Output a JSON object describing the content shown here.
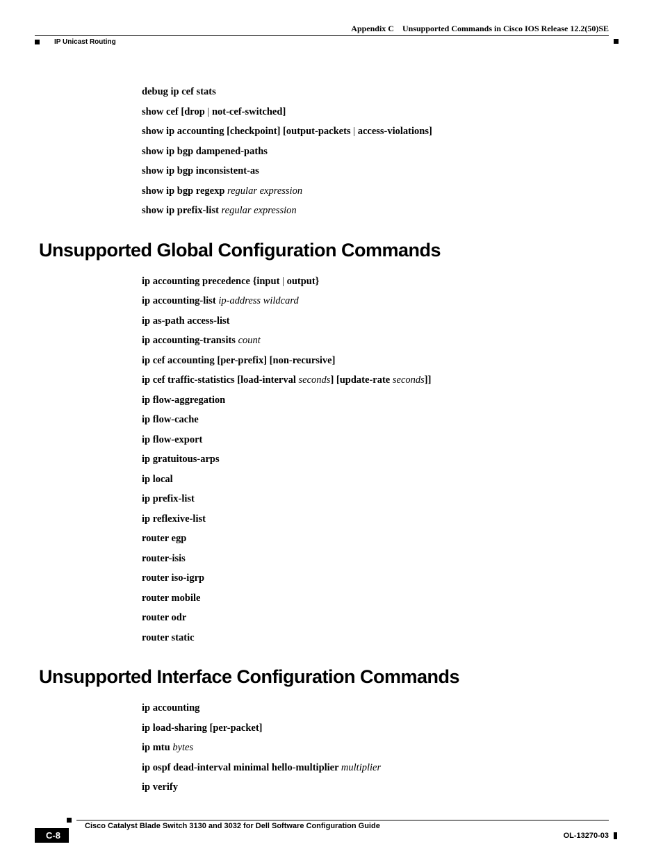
{
  "header": {
    "appendix_bold": "Appendix C",
    "appendix_text": "Unsupported Commands in Cisco IOS Release 12.2(50)SE",
    "section": "IP Unicast Routing"
  },
  "block1": [
    [
      {
        "t": "debug ip cef stats",
        "b": true
      }
    ],
    [
      {
        "t": "show cef ",
        "b": true
      },
      {
        "t": "[",
        "b": true
      },
      {
        "t": "drop",
        "b": true
      },
      {
        "t": " | ",
        "b": false
      },
      {
        "t": "not-cef-switched",
        "b": true
      },
      {
        "t": "]",
        "b": true
      }
    ],
    [
      {
        "t": "show ip accounting ",
        "b": true
      },
      {
        "t": "[",
        "b": true
      },
      {
        "t": "checkpoint",
        "b": true
      },
      {
        "t": "] [",
        "b": true
      },
      {
        "t": "output-packets",
        "b": true
      },
      {
        "t": " | ",
        "b": false
      },
      {
        "t": "access-violations",
        "b": true
      },
      {
        "t": "]",
        "b": true
      }
    ],
    [
      {
        "t": "show ip bgp dampened-paths",
        "b": true
      }
    ],
    [
      {
        "t": "show ip bgp inconsistent-as",
        "b": true
      }
    ],
    [
      {
        "t": "show ip bgp regexp ",
        "b": true
      },
      {
        "t": "regular expression",
        "i": true
      }
    ],
    [
      {
        "t": "show ip prefix-list ",
        "b": true
      },
      {
        "t": "regular expression",
        "i": true
      }
    ]
  ],
  "heading1": "Unsupported Global Configuration Commands",
  "block2": [
    [
      {
        "t": "ip accounting precedence ",
        "b": true
      },
      {
        "t": "{",
        "b": true
      },
      {
        "t": "input",
        "b": true
      },
      {
        "t": " | ",
        "b": false
      },
      {
        "t": "output",
        "b": true
      },
      {
        "t": "}",
        "b": true
      }
    ],
    [
      {
        "t": "ip accounting-list ",
        "b": true
      },
      {
        "t": "ip-address wildcard",
        "i": true
      }
    ],
    [
      {
        "t": "ip as-path access-list",
        "b": true
      }
    ],
    [
      {
        "t": "ip accounting-transits ",
        "b": true
      },
      {
        "t": "count",
        "i": true
      }
    ],
    [
      {
        "t": "ip cef accounting ",
        "b": true
      },
      {
        "t": "[",
        "b": true
      },
      {
        "t": "per-prefix",
        "b": true
      },
      {
        "t": "] [",
        "b": true
      },
      {
        "t": "non-recursive",
        "b": true
      },
      {
        "t": "]",
        "b": true
      }
    ],
    [
      {
        "t": "ip cef traffic-statistics ",
        "b": true
      },
      {
        "t": "[",
        "b": true
      },
      {
        "t": "load-interval ",
        "b": true
      },
      {
        "t": "seconds",
        "i": true
      },
      {
        "t": "] [",
        "b": true
      },
      {
        "t": "update-rate ",
        "b": true
      },
      {
        "t": "seconds",
        "i": true
      },
      {
        "t": "]]",
        "b": true
      }
    ],
    [
      {
        "t": "ip flow-aggregation",
        "b": true
      }
    ],
    [
      {
        "t": "ip flow-cache",
        "b": true
      }
    ],
    [
      {
        "t": "ip flow-export",
        "b": true
      }
    ],
    [
      {
        "t": "ip gratuitous-arps",
        "b": true
      }
    ],
    [
      {
        "t": "ip local",
        "b": true
      }
    ],
    [
      {
        "t": "ip prefix-list",
        "b": true
      }
    ],
    [
      {
        "t": "ip reflexive-list",
        "b": true
      }
    ],
    [
      {
        "t": "router egp",
        "b": true
      }
    ],
    [
      {
        "t": "router-isis",
        "b": true
      }
    ],
    [
      {
        "t": "router iso-igrp",
        "b": true
      }
    ],
    [
      {
        "t": "router mobile",
        "b": true
      }
    ],
    [
      {
        "t": "router odr",
        "b": true
      }
    ],
    [
      {
        "t": "router static",
        "b": true
      }
    ]
  ],
  "heading2": "Unsupported Interface Configuration Commands",
  "block3": [
    [
      {
        "t": "ip accounting",
        "b": true
      }
    ],
    [
      {
        "t": "ip load-sharing ",
        "b": true
      },
      {
        "t": "[",
        "b": true
      },
      {
        "t": "per-packet",
        "b": true
      },
      {
        "t": "]",
        "b": true
      }
    ],
    [
      {
        "t": "ip mtu ",
        "b": true
      },
      {
        "t": "bytes",
        "i": true
      }
    ],
    [
      {
        "t": "ip ospf dead-interval minimal hello-multiplier ",
        "b": true
      },
      {
        "t": "multiplier",
        "i": true
      }
    ],
    [
      {
        "t": "ip verify",
        "b": true
      }
    ]
  ],
  "footer": {
    "title": "Cisco Catalyst Blade Switch 3130 and 3032 for Dell Software Configuration Guide",
    "page": "C-8",
    "docnum": "OL-13270-03"
  }
}
